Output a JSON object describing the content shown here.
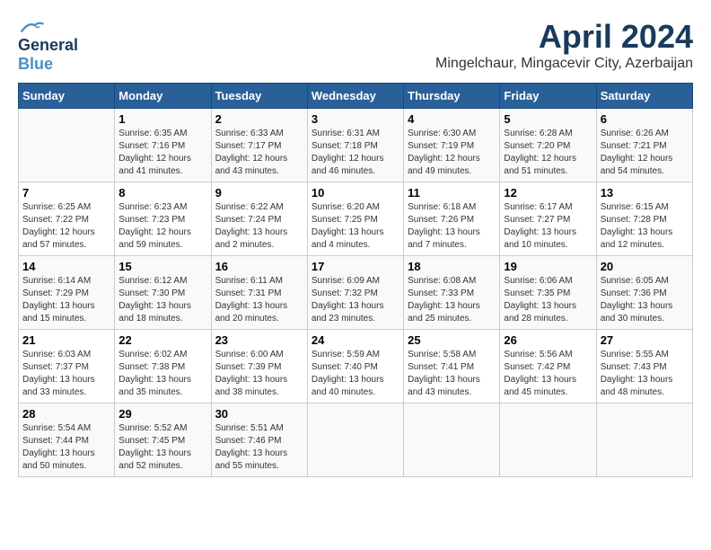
{
  "header": {
    "logo_general": "General",
    "logo_blue": "Blue",
    "title": "April 2024",
    "subtitle": "Mingelchaur, Mingacevir City, Azerbaijan"
  },
  "calendar": {
    "days_of_week": [
      "Sunday",
      "Monday",
      "Tuesday",
      "Wednesday",
      "Thursday",
      "Friday",
      "Saturday"
    ],
    "weeks": [
      [
        {
          "day": "",
          "info": ""
        },
        {
          "day": "1",
          "info": "Sunrise: 6:35 AM\nSunset: 7:16 PM\nDaylight: 12 hours\nand 41 minutes."
        },
        {
          "day": "2",
          "info": "Sunrise: 6:33 AM\nSunset: 7:17 PM\nDaylight: 12 hours\nand 43 minutes."
        },
        {
          "day": "3",
          "info": "Sunrise: 6:31 AM\nSunset: 7:18 PM\nDaylight: 12 hours\nand 46 minutes."
        },
        {
          "day": "4",
          "info": "Sunrise: 6:30 AM\nSunset: 7:19 PM\nDaylight: 12 hours\nand 49 minutes."
        },
        {
          "day": "5",
          "info": "Sunrise: 6:28 AM\nSunset: 7:20 PM\nDaylight: 12 hours\nand 51 minutes."
        },
        {
          "day": "6",
          "info": "Sunrise: 6:26 AM\nSunset: 7:21 PM\nDaylight: 12 hours\nand 54 minutes."
        }
      ],
      [
        {
          "day": "7",
          "info": "Sunrise: 6:25 AM\nSunset: 7:22 PM\nDaylight: 12 hours\nand 57 minutes."
        },
        {
          "day": "8",
          "info": "Sunrise: 6:23 AM\nSunset: 7:23 PM\nDaylight: 12 hours\nand 59 minutes."
        },
        {
          "day": "9",
          "info": "Sunrise: 6:22 AM\nSunset: 7:24 PM\nDaylight: 13 hours\nand 2 minutes."
        },
        {
          "day": "10",
          "info": "Sunrise: 6:20 AM\nSunset: 7:25 PM\nDaylight: 13 hours\nand 4 minutes."
        },
        {
          "day": "11",
          "info": "Sunrise: 6:18 AM\nSunset: 7:26 PM\nDaylight: 13 hours\nand 7 minutes."
        },
        {
          "day": "12",
          "info": "Sunrise: 6:17 AM\nSunset: 7:27 PM\nDaylight: 13 hours\nand 10 minutes."
        },
        {
          "day": "13",
          "info": "Sunrise: 6:15 AM\nSunset: 7:28 PM\nDaylight: 13 hours\nand 12 minutes."
        }
      ],
      [
        {
          "day": "14",
          "info": "Sunrise: 6:14 AM\nSunset: 7:29 PM\nDaylight: 13 hours\nand 15 minutes."
        },
        {
          "day": "15",
          "info": "Sunrise: 6:12 AM\nSunset: 7:30 PM\nDaylight: 13 hours\nand 18 minutes."
        },
        {
          "day": "16",
          "info": "Sunrise: 6:11 AM\nSunset: 7:31 PM\nDaylight: 13 hours\nand 20 minutes."
        },
        {
          "day": "17",
          "info": "Sunrise: 6:09 AM\nSunset: 7:32 PM\nDaylight: 13 hours\nand 23 minutes."
        },
        {
          "day": "18",
          "info": "Sunrise: 6:08 AM\nSunset: 7:33 PM\nDaylight: 13 hours\nand 25 minutes."
        },
        {
          "day": "19",
          "info": "Sunrise: 6:06 AM\nSunset: 7:35 PM\nDaylight: 13 hours\nand 28 minutes."
        },
        {
          "day": "20",
          "info": "Sunrise: 6:05 AM\nSunset: 7:36 PM\nDaylight: 13 hours\nand 30 minutes."
        }
      ],
      [
        {
          "day": "21",
          "info": "Sunrise: 6:03 AM\nSunset: 7:37 PM\nDaylight: 13 hours\nand 33 minutes."
        },
        {
          "day": "22",
          "info": "Sunrise: 6:02 AM\nSunset: 7:38 PM\nDaylight: 13 hours\nand 35 minutes."
        },
        {
          "day": "23",
          "info": "Sunrise: 6:00 AM\nSunset: 7:39 PM\nDaylight: 13 hours\nand 38 minutes."
        },
        {
          "day": "24",
          "info": "Sunrise: 5:59 AM\nSunset: 7:40 PM\nDaylight: 13 hours\nand 40 minutes."
        },
        {
          "day": "25",
          "info": "Sunrise: 5:58 AM\nSunset: 7:41 PM\nDaylight: 13 hours\nand 43 minutes."
        },
        {
          "day": "26",
          "info": "Sunrise: 5:56 AM\nSunset: 7:42 PM\nDaylight: 13 hours\nand 45 minutes."
        },
        {
          "day": "27",
          "info": "Sunrise: 5:55 AM\nSunset: 7:43 PM\nDaylight: 13 hours\nand 48 minutes."
        }
      ],
      [
        {
          "day": "28",
          "info": "Sunrise: 5:54 AM\nSunset: 7:44 PM\nDaylight: 13 hours\nand 50 minutes."
        },
        {
          "day": "29",
          "info": "Sunrise: 5:52 AM\nSunset: 7:45 PM\nDaylight: 13 hours\nand 52 minutes."
        },
        {
          "day": "30",
          "info": "Sunrise: 5:51 AM\nSunset: 7:46 PM\nDaylight: 13 hours\nand 55 minutes."
        },
        {
          "day": "",
          "info": ""
        },
        {
          "day": "",
          "info": ""
        },
        {
          "day": "",
          "info": ""
        },
        {
          "day": "",
          "info": ""
        }
      ]
    ]
  }
}
